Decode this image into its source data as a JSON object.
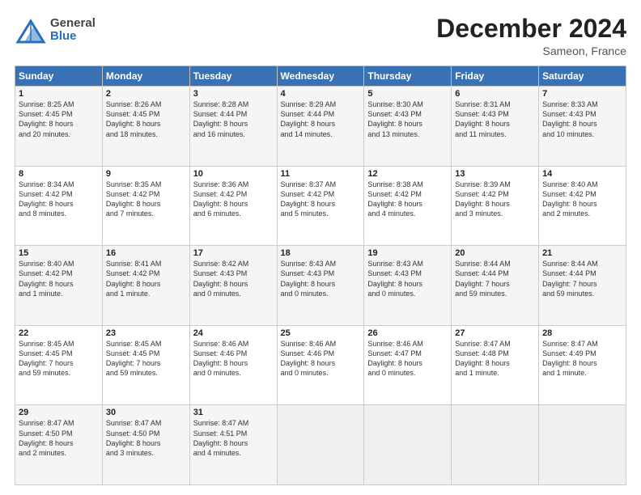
{
  "header": {
    "logo_general": "General",
    "logo_blue": "Blue",
    "month_title": "December 2024",
    "location": "Sameon, France"
  },
  "days_of_week": [
    "Sunday",
    "Monday",
    "Tuesday",
    "Wednesday",
    "Thursday",
    "Friday",
    "Saturday"
  ],
  "weeks": [
    [
      {
        "day": "1",
        "lines": [
          "Sunrise: 8:25 AM",
          "Sunset: 4:45 PM",
          "Daylight: 8 hours",
          "and 20 minutes."
        ]
      },
      {
        "day": "2",
        "lines": [
          "Sunrise: 8:26 AM",
          "Sunset: 4:45 PM",
          "Daylight: 8 hours",
          "and 18 minutes."
        ]
      },
      {
        "day": "3",
        "lines": [
          "Sunrise: 8:28 AM",
          "Sunset: 4:44 PM",
          "Daylight: 8 hours",
          "and 16 minutes."
        ]
      },
      {
        "day": "4",
        "lines": [
          "Sunrise: 8:29 AM",
          "Sunset: 4:44 PM",
          "Daylight: 8 hours",
          "and 14 minutes."
        ]
      },
      {
        "day": "5",
        "lines": [
          "Sunrise: 8:30 AM",
          "Sunset: 4:43 PM",
          "Daylight: 8 hours",
          "and 13 minutes."
        ]
      },
      {
        "day": "6",
        "lines": [
          "Sunrise: 8:31 AM",
          "Sunset: 4:43 PM",
          "Daylight: 8 hours",
          "and 11 minutes."
        ]
      },
      {
        "day": "7",
        "lines": [
          "Sunrise: 8:33 AM",
          "Sunset: 4:43 PM",
          "Daylight: 8 hours",
          "and 10 minutes."
        ]
      }
    ],
    [
      {
        "day": "8",
        "lines": [
          "Sunrise: 8:34 AM",
          "Sunset: 4:42 PM",
          "Daylight: 8 hours",
          "and 8 minutes."
        ]
      },
      {
        "day": "9",
        "lines": [
          "Sunrise: 8:35 AM",
          "Sunset: 4:42 PM",
          "Daylight: 8 hours",
          "and 7 minutes."
        ]
      },
      {
        "day": "10",
        "lines": [
          "Sunrise: 8:36 AM",
          "Sunset: 4:42 PM",
          "Daylight: 8 hours",
          "and 6 minutes."
        ]
      },
      {
        "day": "11",
        "lines": [
          "Sunrise: 8:37 AM",
          "Sunset: 4:42 PM",
          "Daylight: 8 hours",
          "and 5 minutes."
        ]
      },
      {
        "day": "12",
        "lines": [
          "Sunrise: 8:38 AM",
          "Sunset: 4:42 PM",
          "Daylight: 8 hours",
          "and 4 minutes."
        ]
      },
      {
        "day": "13",
        "lines": [
          "Sunrise: 8:39 AM",
          "Sunset: 4:42 PM",
          "Daylight: 8 hours",
          "and 3 minutes."
        ]
      },
      {
        "day": "14",
        "lines": [
          "Sunrise: 8:40 AM",
          "Sunset: 4:42 PM",
          "Daylight: 8 hours",
          "and 2 minutes."
        ]
      }
    ],
    [
      {
        "day": "15",
        "lines": [
          "Sunrise: 8:40 AM",
          "Sunset: 4:42 PM",
          "Daylight: 8 hours",
          "and 1 minute."
        ]
      },
      {
        "day": "16",
        "lines": [
          "Sunrise: 8:41 AM",
          "Sunset: 4:42 PM",
          "Daylight: 8 hours",
          "and 1 minute."
        ]
      },
      {
        "day": "17",
        "lines": [
          "Sunrise: 8:42 AM",
          "Sunset: 4:43 PM",
          "Daylight: 8 hours",
          "and 0 minutes."
        ]
      },
      {
        "day": "18",
        "lines": [
          "Sunrise: 8:43 AM",
          "Sunset: 4:43 PM",
          "Daylight: 8 hours",
          "and 0 minutes."
        ]
      },
      {
        "day": "19",
        "lines": [
          "Sunrise: 8:43 AM",
          "Sunset: 4:43 PM",
          "Daylight: 8 hours",
          "and 0 minutes."
        ]
      },
      {
        "day": "20",
        "lines": [
          "Sunrise: 8:44 AM",
          "Sunset: 4:44 PM",
          "Daylight: 7 hours",
          "and 59 minutes."
        ]
      },
      {
        "day": "21",
        "lines": [
          "Sunrise: 8:44 AM",
          "Sunset: 4:44 PM",
          "Daylight: 7 hours",
          "and 59 minutes."
        ]
      }
    ],
    [
      {
        "day": "22",
        "lines": [
          "Sunrise: 8:45 AM",
          "Sunset: 4:45 PM",
          "Daylight: 7 hours",
          "and 59 minutes."
        ]
      },
      {
        "day": "23",
        "lines": [
          "Sunrise: 8:45 AM",
          "Sunset: 4:45 PM",
          "Daylight: 7 hours",
          "and 59 minutes."
        ]
      },
      {
        "day": "24",
        "lines": [
          "Sunrise: 8:46 AM",
          "Sunset: 4:46 PM",
          "Daylight: 8 hours",
          "and 0 minutes."
        ]
      },
      {
        "day": "25",
        "lines": [
          "Sunrise: 8:46 AM",
          "Sunset: 4:46 PM",
          "Daylight: 8 hours",
          "and 0 minutes."
        ]
      },
      {
        "day": "26",
        "lines": [
          "Sunrise: 8:46 AM",
          "Sunset: 4:47 PM",
          "Daylight: 8 hours",
          "and 0 minutes."
        ]
      },
      {
        "day": "27",
        "lines": [
          "Sunrise: 8:47 AM",
          "Sunset: 4:48 PM",
          "Daylight: 8 hours",
          "and 1 minute."
        ]
      },
      {
        "day": "28",
        "lines": [
          "Sunrise: 8:47 AM",
          "Sunset: 4:49 PM",
          "Daylight: 8 hours",
          "and 1 minute."
        ]
      }
    ],
    [
      {
        "day": "29",
        "lines": [
          "Sunrise: 8:47 AM",
          "Sunset: 4:50 PM",
          "Daylight: 8 hours",
          "and 2 minutes."
        ]
      },
      {
        "day": "30",
        "lines": [
          "Sunrise: 8:47 AM",
          "Sunset: 4:50 PM",
          "Daylight: 8 hours",
          "and 3 minutes."
        ]
      },
      {
        "day": "31",
        "lines": [
          "Sunrise: 8:47 AM",
          "Sunset: 4:51 PM",
          "Daylight: 8 hours",
          "and 4 minutes."
        ]
      },
      null,
      null,
      null,
      null
    ]
  ]
}
